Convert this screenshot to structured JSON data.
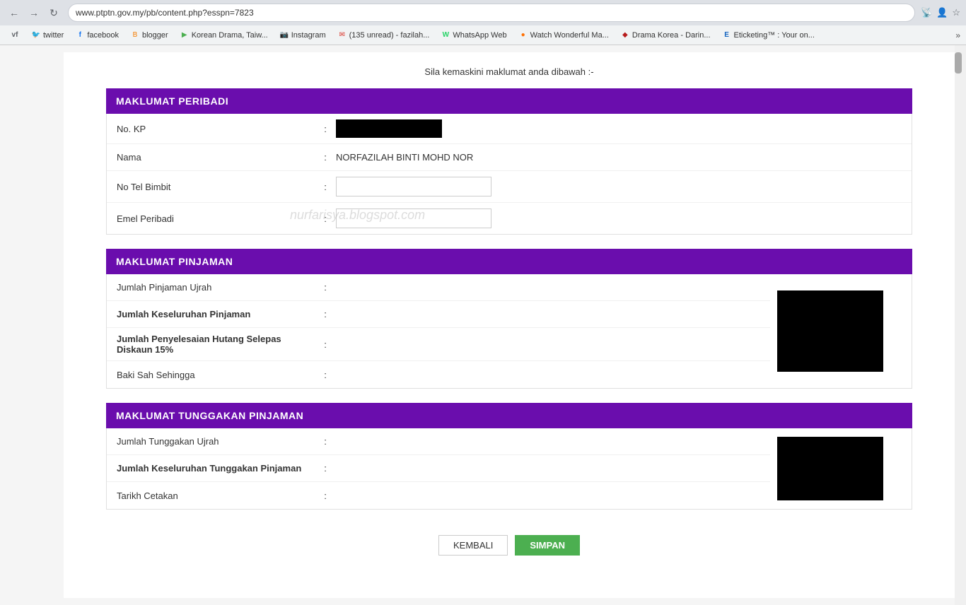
{
  "browser": {
    "url": "www.ptptn.gov.my/pb/content.php?esspn=7823",
    "bookmarks": [
      {
        "label": "vf",
        "icon": "vf",
        "color": "#333"
      },
      {
        "label": "twitter",
        "icon": "twitter",
        "color": "#1da1f2"
      },
      {
        "label": "facebook",
        "icon": "f",
        "color": "#1877f2"
      },
      {
        "label": "blogger",
        "icon": "B",
        "color": "#f57c00"
      },
      {
        "label": "Korean Drama, Taiw...",
        "icon": "▶",
        "color": "#4caf50"
      },
      {
        "label": "Instagram",
        "icon": "📷",
        "color": "#c13584"
      },
      {
        "label": "(135 unread) - fazilah...",
        "icon": "✉",
        "color": "#d93025"
      },
      {
        "label": "WhatsApp Web",
        "icon": "W",
        "color": "#25d366"
      },
      {
        "label": "Watch Wonderful Ma...",
        "icon": "●",
        "color": "#ff6f00"
      },
      {
        "label": "Drama Korea - Daring...",
        "icon": "◆",
        "color": "#b71c1c"
      },
      {
        "label": "Eticketing™ : Your on...",
        "icon": "E",
        "color": "#1565c0"
      }
    ]
  },
  "page": {
    "instruction": "Sila kemaskini maklumat anda dibawah :-",
    "watermark": "nurfarisya.blogspot.com",
    "sections": {
      "peribadi": {
        "header": "MAKLUMAT PERIBADI",
        "fields": [
          {
            "label": "No. KP",
            "bold": false,
            "type": "redacted"
          },
          {
            "label": "Nama",
            "bold": false,
            "type": "text",
            "value": "NORFAZILAH BINTI MOHD NOR"
          },
          {
            "label": "No Tel Bimbit",
            "bold": false,
            "type": "input"
          },
          {
            "label": "Emel Peribadi",
            "bold": false,
            "type": "input"
          }
        ]
      },
      "pinjaman": {
        "header": "MAKLUMAT PINJAMAN",
        "fields": [
          {
            "label": "Jumlah Pinjaman Ujrah",
            "bold": false
          },
          {
            "label": "Jumlah Keseluruhan Pinjaman",
            "bold": true
          },
          {
            "label": "Jumlah Penyelesaian Hutang Selepas Diskaun 15%",
            "bold": true
          },
          {
            "label": "Baki Sah Sehingga",
            "bold": false
          }
        ]
      },
      "tunggakan": {
        "header": "MAKLUMAT TUNGGAKAN PINJAMAN",
        "fields": [
          {
            "label": "Jumlah Tunggakan Ujrah",
            "bold": false
          },
          {
            "label": "Jumlah Keseluruhan Tunggakan Pinjaman",
            "bold": true
          },
          {
            "label": "Tarikh Cetakan",
            "bold": false
          }
        ]
      }
    },
    "buttons": {
      "kembali": "KEMBALI",
      "simpan": "SIMPAN"
    }
  }
}
